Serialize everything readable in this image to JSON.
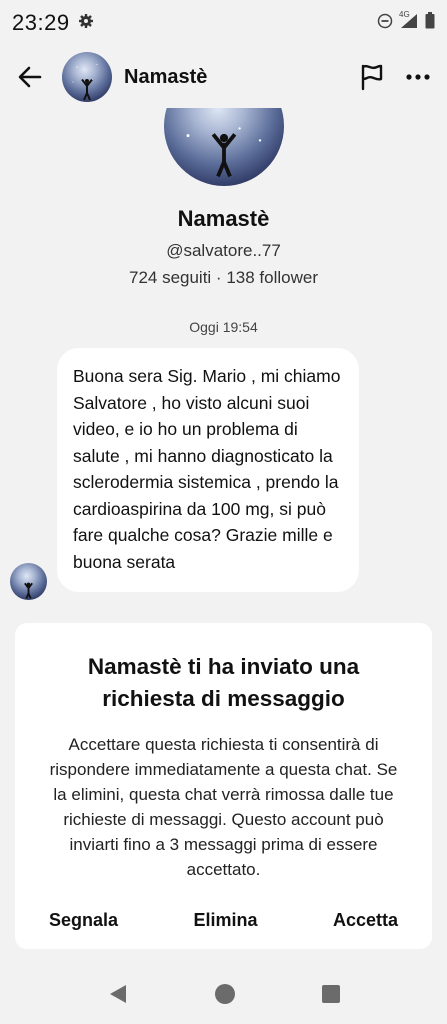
{
  "status_bar": {
    "time": "23:29",
    "network_label": "4G",
    "icons": [
      "gear-icon",
      "do-not-disturb-icon",
      "signal-icon",
      "battery-icon"
    ]
  },
  "header": {
    "title": "Namastè",
    "icons": [
      "back-arrow-icon",
      "flag-icon",
      "more-icon"
    ]
  },
  "profile": {
    "name": "Namastè",
    "handle": "@salvatore..77",
    "stats": "724 seguiti · 138 follower"
  },
  "conversation": {
    "timestamp": "Oggi 19:54",
    "message": "Buona sera Sig. Mario , mi chiamo Salvatore , ho visto alcuni suoi video, e io ho un problema di salute , mi hanno diagnosticato la sclerodermia sistemica , prendo la cardioaspirina da 100 mg, si può fare qualche cosa? Grazie mille e buona serata"
  },
  "request": {
    "title": "Namastè ti ha inviato una richiesta di messaggio",
    "body": "Accettare questa richiesta ti consentirà di rispondere immediatamente a questa chat. Se la elimini, questa chat verrà rimossa dalle tue richieste di messaggi. Questo account può inviarti fino a 3 messaggi prima di essere accettato.",
    "actions": {
      "report": "Segnala",
      "delete": "Elimina",
      "accept": "Accetta"
    }
  },
  "colors": {
    "background": "#f2f2f2",
    "card": "#ffffff",
    "text": "#111111"
  }
}
